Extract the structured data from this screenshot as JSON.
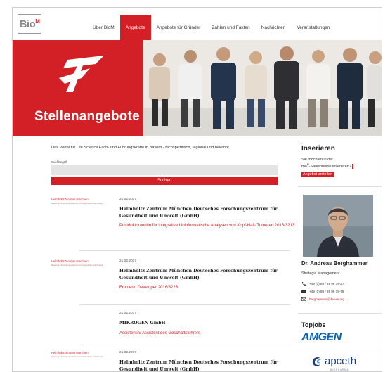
{
  "header": {
    "logo_text": "Bio",
    "logo_sup": "M",
    "nav": [
      {
        "label": "Über BioM",
        "active": false
      },
      {
        "label": "Angebote",
        "active": true
      },
      {
        "label": "Angebote für Gründer",
        "active": false
      },
      {
        "label": "Zahlen und Fakten",
        "active": false
      },
      {
        "label": "Nachrichten",
        "active": false
      },
      {
        "label": "Veranstaltungen",
        "active": false
      }
    ]
  },
  "hero": {
    "title": "Stellenangebote"
  },
  "main": {
    "intro": "Das Portal für Life Science Fach- und Führungskräfte in Bayern - fachspezifisch, regional und bekannt.",
    "search_label": "Suchbegriff",
    "search_value": "",
    "search_button": "Suchen",
    "listings": [
      {
        "logo_line1": "HelmholtzZentrum münchen",
        "logo_line2": "Deutsches Forschungszentrum für Gesundheit und Umwelt",
        "date": "21.02.2017",
        "org": "Helmholtz Zentrum München Deutsches Forschungszentrum für Gesundheit und Umwelt (GmbH)",
        "title": "Postdoktorand/in für integrative bioinformatische Analysen von Kopf-Hals Tumoren 2016/3213"
      },
      {
        "logo_line1": "HelmholtzZentrum münchen",
        "logo_line2": "Deutsches Forschungszentrum für Gesundheit und Umwelt",
        "date": "21.02.2017",
        "org": "Helmholtz Zentrum München Deutsches Forschungszentrum für Gesundheit und Umwelt (GmbH)",
        "title": "Frontend Developer 2016/3226"
      },
      {
        "logo_line1": "",
        "logo_line2": "",
        "date": "21.02.2017",
        "org": "MIKROGEN GmbH",
        "title": "Assistentin/ Assistent des Geschäftsführers"
      },
      {
        "logo_line1": "HelmholtzZentrum münchen",
        "logo_line2": "Deutsches Forschungszentrum für Gesundheit und Umwelt",
        "date": "21.02.2017",
        "org": "Helmholtz Zentrum München Deutsches Forschungszentrum für Gesundheit und Umwelt (GmbH)",
        "title": ""
      }
    ]
  },
  "sidebar": {
    "inserieren_title": "Inserieren",
    "inserieren_text_a": "Sie möchten in der",
    "inserieren_text_b": "Bio",
    "inserieren_text_sup": "M",
    "inserieren_text_c": "-Stellenbörse inserieren?",
    "inserieren_button": "Angebot erstellen",
    "contact_name": "Dr. Andreas Berghammer",
    "contact_role": "Strategic Management",
    "contact_phone": "+49 (0) 89 / 89 96 79-27",
    "contact_fax": "+49 (0) 89 / 89 96 79-79",
    "contact_email": "berghammer@bio-m.org",
    "topjobs_title": "Topjobs",
    "topjobs_1": "AMGEN",
    "topjobs_2": "apceth",
    "topjobs_2_sub": "BIOPHARMA"
  },
  "colors": {
    "brand_red": "#d32027",
    "link_red": "#c8242b",
    "amgen_blue": "#0a63b0",
    "apceth_blue": "#1f3f78"
  }
}
